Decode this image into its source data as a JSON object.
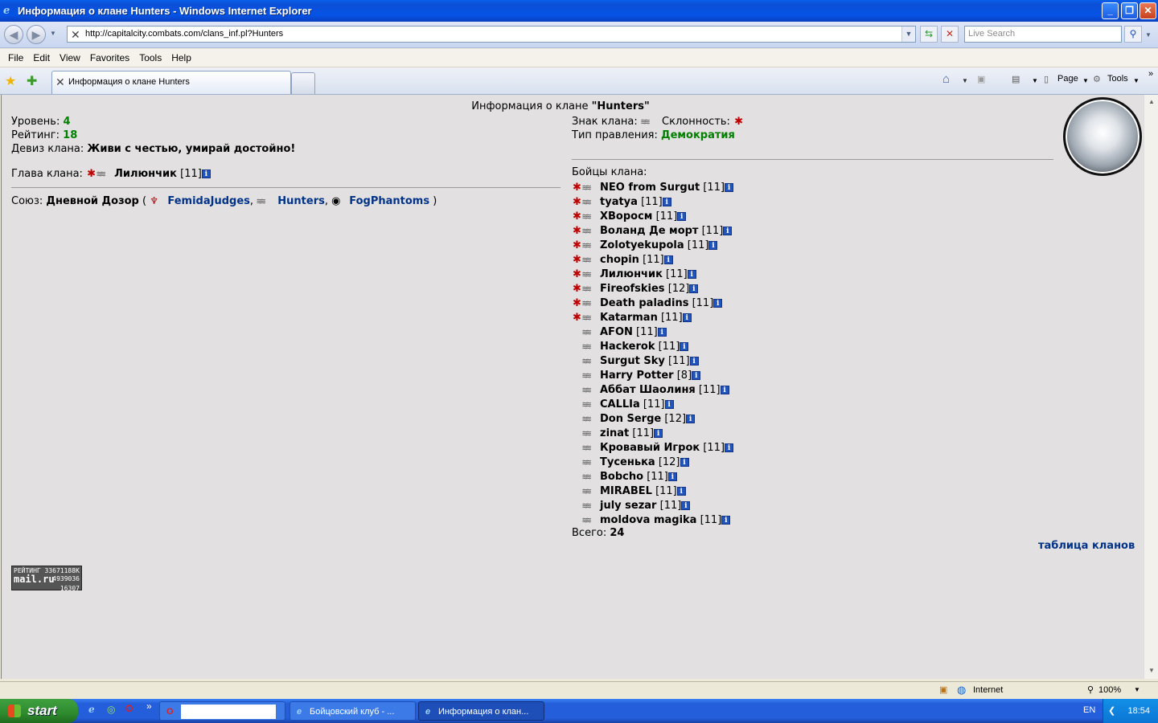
{
  "window": {
    "title": "Информация о клане Hunters - Windows Internet Explorer"
  },
  "address": {
    "url": "http://capitalcity.combats.com/clans_inf.pl?Hunters",
    "search_placeholder": "Live Search"
  },
  "menu": [
    "File",
    "Edit",
    "View",
    "Favorites",
    "Tools",
    "Help"
  ],
  "tab": {
    "label": "Информация о клане Hunters"
  },
  "commandbar": {
    "page": "Page",
    "tools": "Tools"
  },
  "clan": {
    "heading_prefix": "Информация о клане ",
    "heading_name": "\"Hunters\"",
    "level_label": "Уровень: ",
    "level": "4",
    "rating_label": "Рейтинг: ",
    "rating": "18",
    "motto_label": "Девиз клана: ",
    "motto": "Живи с честью, умирай достойно!",
    "sign_label": "Знак клана: ",
    "alignment_label": " Склонность: ",
    "government_label": "Тип правления: ",
    "government": "Демократия",
    "head_label": "Глава клана: ",
    "head_name": "Лилюнчик",
    "head_level": "[11]",
    "union_label": "Союз: ",
    "union_name": "Дневной Дозор",
    "union_paren_open": " (",
    "union_paren_close": " )",
    "allies": [
      "FemidaJudges",
      "Hunters",
      "FogPhantoms"
    ],
    "fighters_label": "Бойцы клана:",
    "total_label": "Всего: ",
    "total": "24",
    "clans_table_link": "таблица кланов"
  },
  "fighters": [
    {
      "name": "NEO from Surgut",
      "level": "[11]",
      "align": true
    },
    {
      "name": "tyatya",
      "level": "[11]",
      "align": true
    },
    {
      "name": "ХВоросм",
      "level": "[11]",
      "align": true
    },
    {
      "name": "Воланд Де морт",
      "level": "[11]",
      "align": true
    },
    {
      "name": "Zolotyekupola",
      "level": "[11]",
      "align": true
    },
    {
      "name": "chopin",
      "level": "[11]",
      "align": true
    },
    {
      "name": "Лилюнчик",
      "level": "[11]",
      "align": true
    },
    {
      "name": "Fireofskies",
      "level": "[12]",
      "align": true
    },
    {
      "name": "Death paladins",
      "level": "[11]",
      "align": true
    },
    {
      "name": "Katarman",
      "level": "[11]",
      "align": true
    },
    {
      "name": "AFON",
      "level": "[11]",
      "align": false
    },
    {
      "name": "Hackerok",
      "level": "[11]",
      "align": false
    },
    {
      "name": "Surgut Sky",
      "level": "[11]",
      "align": false
    },
    {
      "name": "Harry Potter",
      "level": "[8]",
      "align": false
    },
    {
      "name": "Аббат Шаолиня",
      "level": "[11]",
      "align": false
    },
    {
      "name": "CALLIa",
      "level": "[11]",
      "align": false
    },
    {
      "name": "Don Serge",
      "level": "[12]",
      "align": false
    },
    {
      "name": "zinat",
      "level": "[11]",
      "align": false
    },
    {
      "name": "Кровавый Игрок",
      "level": "[11]",
      "align": false
    },
    {
      "name": "Тусенька",
      "level": "[12]",
      "align": false
    },
    {
      "name": "Bobcho",
      "level": "[11]",
      "align": false
    },
    {
      "name": "MIRABEL",
      "level": "[11]",
      "align": false
    },
    {
      "name": "july sezar",
      "level": "[11]",
      "align": false
    },
    {
      "name": "moldova magika",
      "level": "[11]",
      "align": false
    }
  ],
  "mailru": {
    "line1": "РЕЙТИНГ 33671188К",
    "brand": "mail.ru",
    "line2": "4939036",
    "line3": "16307"
  },
  "status": {
    "zone": "Internet",
    "zoom": "100%"
  },
  "taskbar": {
    "start": "start",
    "tasks": [
      "Бойцовский клуб - ...",
      "Информация о клан..."
    ],
    "lang": "EN",
    "time": "18:54"
  }
}
